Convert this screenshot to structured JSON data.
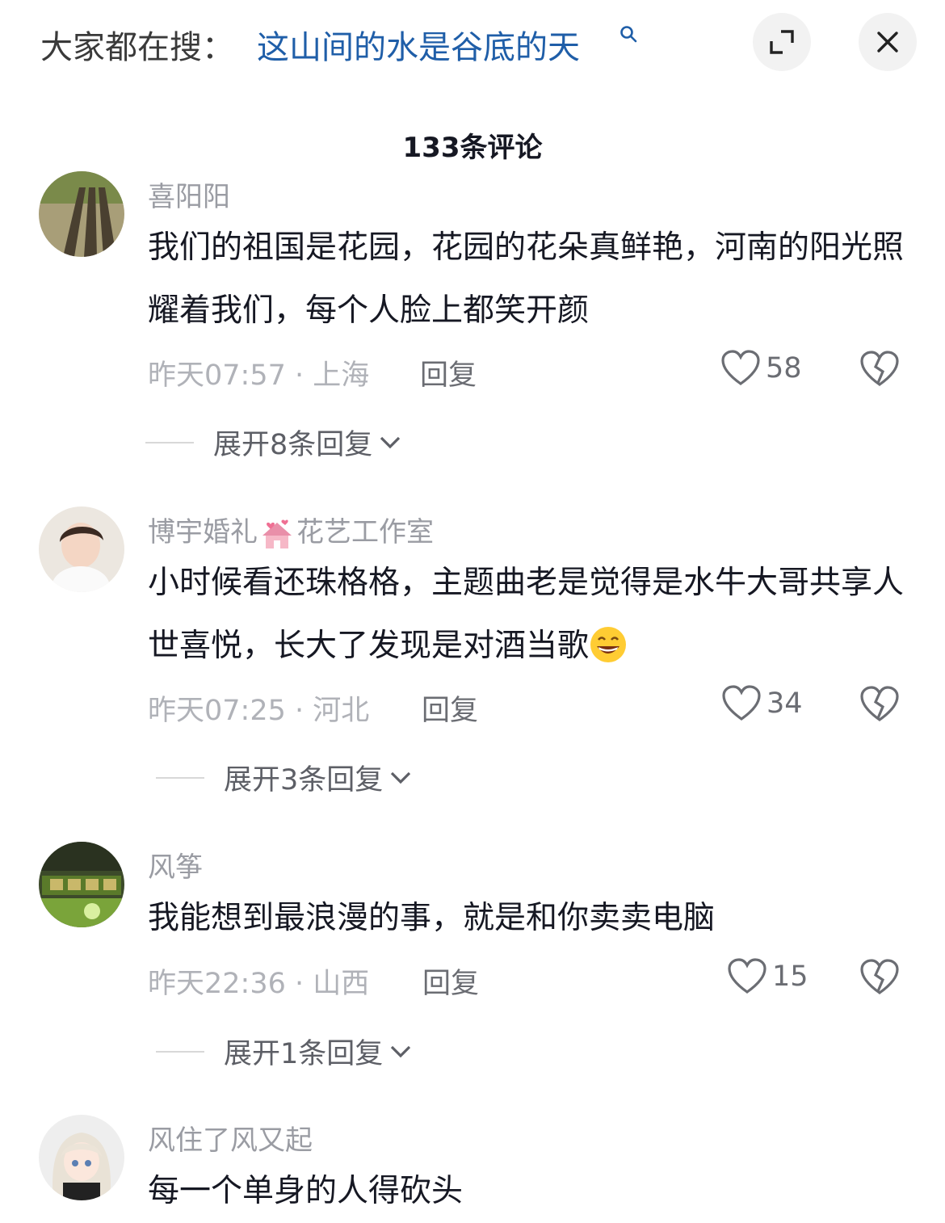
{
  "header": {
    "search_prefix": "大家都在搜：",
    "search_term": "这山间的水是谷底的天",
    "expand_icon": "expand-icon",
    "close_icon": "close-icon"
  },
  "comments_title": "133条评论",
  "comments": [
    {
      "username": "喜阳阳",
      "text": "我们的祖国是花园，花园的花朵真鲜艳，河南的阳光照耀着我们，每个人脸上都笑开颜",
      "time_location": "昨天07:57 · 上海",
      "reply_label": "回复",
      "likes": "58",
      "expand_replies": "展开8条回复"
    },
    {
      "username_part1": "博宇婚礼",
      "username_part2": "花艺工作室",
      "text": "小时候看还珠格格，主题曲老是觉得是水牛大哥共享人世喜悦，长大了发现是对酒当歌",
      "time_location": "昨天07:25 · 河北",
      "reply_label": "回复",
      "likes": "34",
      "expand_replies": "展开3条回复"
    },
    {
      "username": "风筝",
      "text": "我能想到最浪漫的事，就是和你卖卖电脑",
      "time_location": "昨天22:36 · 山西",
      "reply_label": "回复",
      "likes": "15",
      "expand_replies": "展开1条回复"
    },
    {
      "username": "风住了风又起",
      "text": "每一个单身的人得砍头"
    }
  ],
  "icons": {
    "like": "heart-icon",
    "dislike": "broken-heart-icon",
    "chevron": "chevron-down-icon",
    "emoji": "grin-emoji-icon"
  },
  "colors": {
    "search_term": "#1f5ea8",
    "muted_text": "#b0b2b8",
    "username": "#9a9ca3"
  }
}
